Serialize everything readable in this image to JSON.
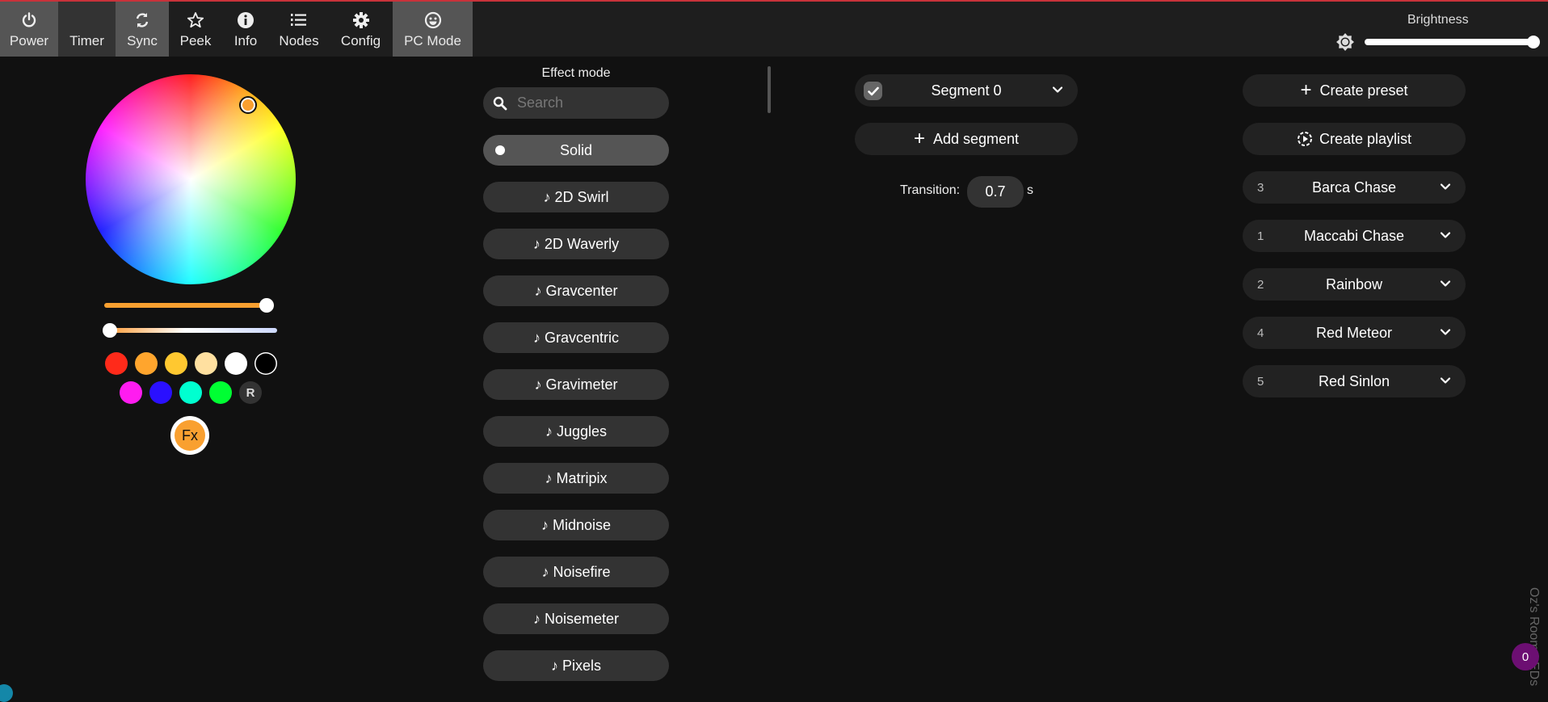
{
  "header": {
    "tabs": [
      {
        "label": "Power",
        "icon": "power-icon",
        "active": true
      },
      {
        "label": "Timer",
        "icon": "moon-icon",
        "active": false
      },
      {
        "label": "Sync",
        "icon": "sync-icon",
        "active": true
      },
      {
        "label": "Peek",
        "icon": "star-icon",
        "active": false
      },
      {
        "label": "Info",
        "icon": "info-icon",
        "active": false
      },
      {
        "label": "Nodes",
        "icon": "list-icon",
        "active": false
      },
      {
        "label": "Config",
        "icon": "gear-icon",
        "active": false
      },
      {
        "label": "PC Mode",
        "icon": "smiley-icon",
        "active": true
      }
    ],
    "brightness": {
      "label": "Brightness",
      "value_percent": 100
    }
  },
  "colors": {
    "accent": "#f9a030",
    "top_border": "#c8323a",
    "badge": "#6c0f72",
    "selected_color": "#f9a030"
  },
  "color_panel": {
    "slider1_percent": 100,
    "slider2_percent": 0,
    "swatches_row1": [
      "#ff2a1a",
      "#ffa52d",
      "#ffc830",
      "#ffe0a0",
      "#ffffff",
      "#000000"
    ],
    "swatches_row2": [
      "#ff1cf0",
      "#2a10ff",
      "#00ffd0",
      "#00ff33"
    ],
    "random_label": "R",
    "fx_label": "Fx"
  },
  "effects": {
    "title": "Effect mode",
    "search_placeholder": "Search",
    "items": [
      {
        "label": "Solid",
        "selected": true
      },
      {
        "label": "♪ 2D Swirl"
      },
      {
        "label": "♪ 2D Waverly"
      },
      {
        "label": "♪ Gravcenter"
      },
      {
        "label": "♪ Gravcentric"
      },
      {
        "label": "♪ Gravimeter"
      },
      {
        "label": "♪ Juggles"
      },
      {
        "label": "♪ Matripix"
      },
      {
        "label": "♪ Midnoise"
      },
      {
        "label": "♪ Noisefire"
      },
      {
        "label": "♪ Noisemeter"
      },
      {
        "label": "♪ Pixels"
      }
    ]
  },
  "segments": {
    "segment_label": "Segment 0",
    "add_label": "Add segment",
    "transition_label": "Transition:",
    "transition_value": "0.7",
    "transition_unit": "s"
  },
  "presets": {
    "create_preset": "Create preset",
    "create_playlist": "Create playlist",
    "items": [
      {
        "num": "3",
        "name": "Barca Chase"
      },
      {
        "num": "1",
        "name": "Maccabi Chase"
      },
      {
        "num": "2",
        "name": "Rainbow"
      },
      {
        "num": "4",
        "name": "Red Meteor"
      },
      {
        "num": "5",
        "name": "Red Sinlon"
      }
    ]
  },
  "footer": {
    "device_name": "Oz's Room LEDs",
    "badge_count": "0"
  }
}
